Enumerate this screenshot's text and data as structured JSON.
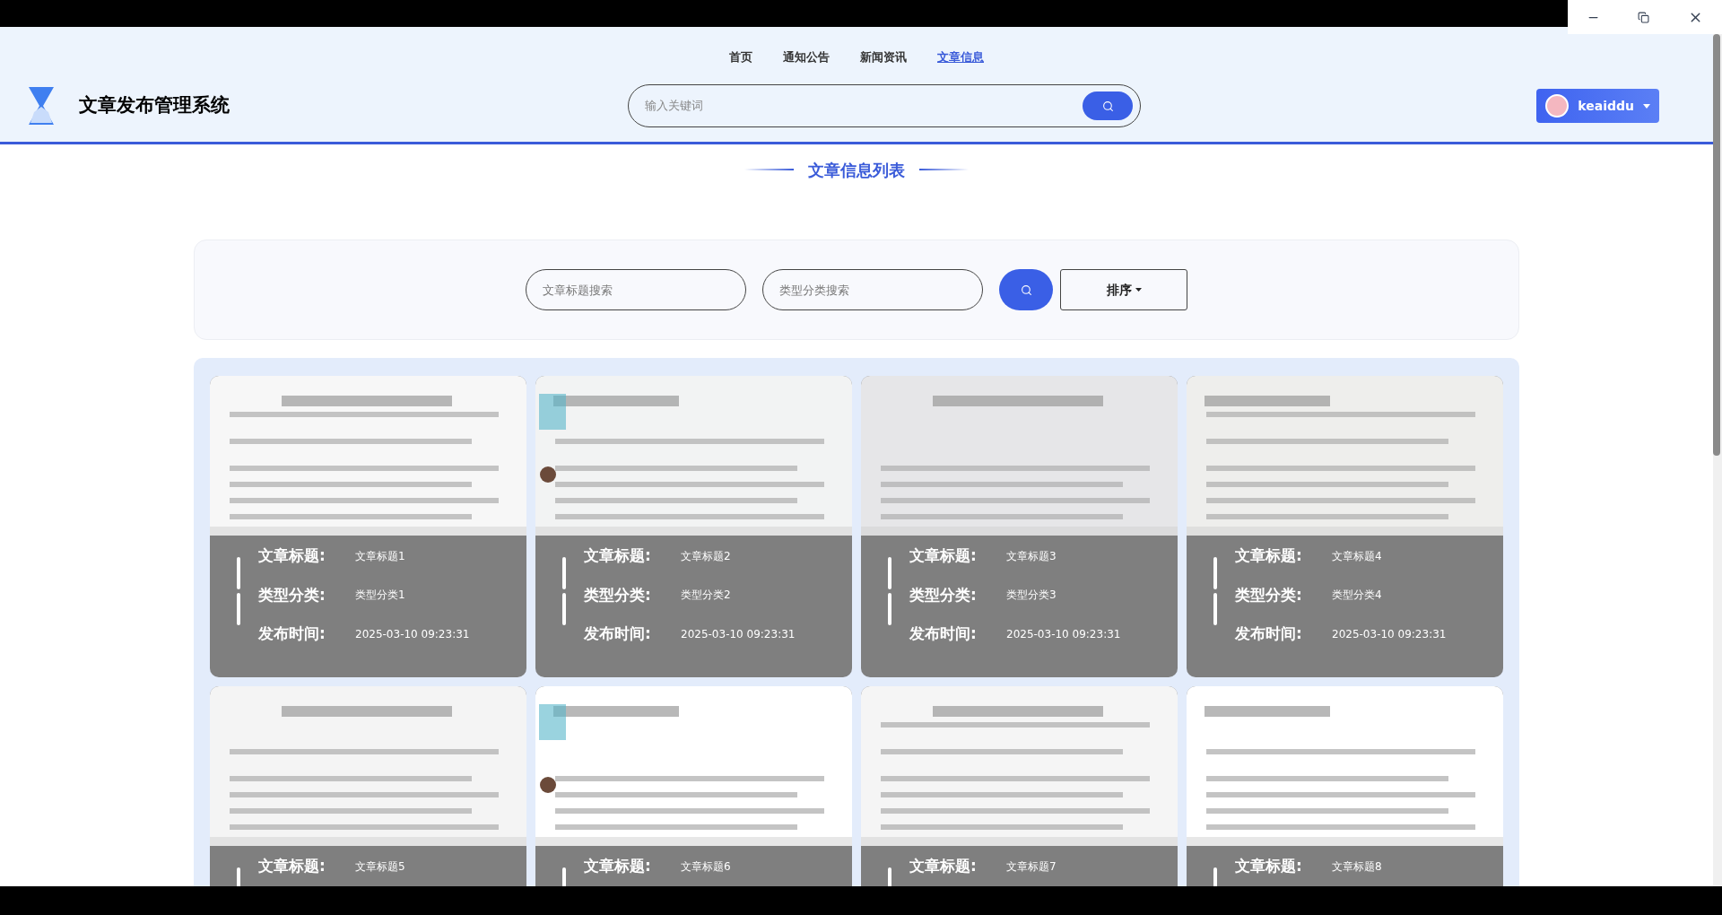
{
  "nav": [
    {
      "label": "首页",
      "selected": false
    },
    {
      "label": "通知公告",
      "selected": false
    },
    {
      "label": "新闻资讯",
      "selected": false
    },
    {
      "label": "文章信息",
      "selected": true
    }
  ],
  "header": {
    "title": "文章发布管理系统",
    "search": {
      "placeholder": "输入关键词"
    },
    "user": "keaiddu"
  },
  "section_title": "文章信息列表",
  "filters": {
    "title_search": {
      "placeholder": "文章标题搜索"
    },
    "category_search": {
      "placeholder": "类型分类搜索"
    },
    "sort_label": "排序"
  },
  "articles": [
    {
      "image": {
        "kind": "picture"
      },
      "fields": [
        {
          "label": "文章标题:",
          "value": "文章标题1"
        },
        {
          "label": "类型分类:",
          "value": "类型分类1"
        },
        {
          "label": "发布时间:",
          "value": "2025-03-10 09:23:31"
        }
      ]
    },
    {
      "image": {
        "kind": "picture"
      },
      "fields": [
        {
          "label": "文章标题:",
          "value": "文章标题2"
        },
        {
          "label": "类型分类:",
          "value": "类型分类2"
        },
        {
          "label": "发布时间:",
          "value": "2025-03-10 09:23:31"
        }
      ]
    },
    {
      "image": {
        "kind": "picture"
      },
      "fields": [
        {
          "label": "文章标题:",
          "value": "文章标题3"
        },
        {
          "label": "类型分类:",
          "value": "类型分类3"
        },
        {
          "label": "发布时间:",
          "value": "2025-03-10 09:23:31"
        }
      ]
    },
    {
      "image": {
        "kind": "picture"
      },
      "fields": [
        {
          "label": "文章标题:",
          "value": "文章标题4"
        },
        {
          "label": "类型分类:",
          "value": "类型分类4"
        },
        {
          "label": "发布时间:",
          "value": "2025-03-10 09:23:31"
        }
      ]
    },
    {
      "image": {
        "kind": "picture"
      },
      "fields": [
        {
          "label": "文章标题:",
          "value": "文章标题5"
        }
      ]
    },
    {
      "image": {
        "kind": "picture"
      },
      "fields": [
        {
          "label": "文章标题:",
          "value": "文章标题6"
        }
      ]
    },
    {
      "image": {
        "kind": "picture"
      },
      "fields": [
        {
          "label": "文章标题:",
          "value": "文章标题7"
        }
      ]
    },
    {
      "image": {
        "kind": "picture"
      },
      "fields": [
        {
          "label": "文章标题:",
          "value": "文章标题8"
        }
      ]
    }
  ]
}
